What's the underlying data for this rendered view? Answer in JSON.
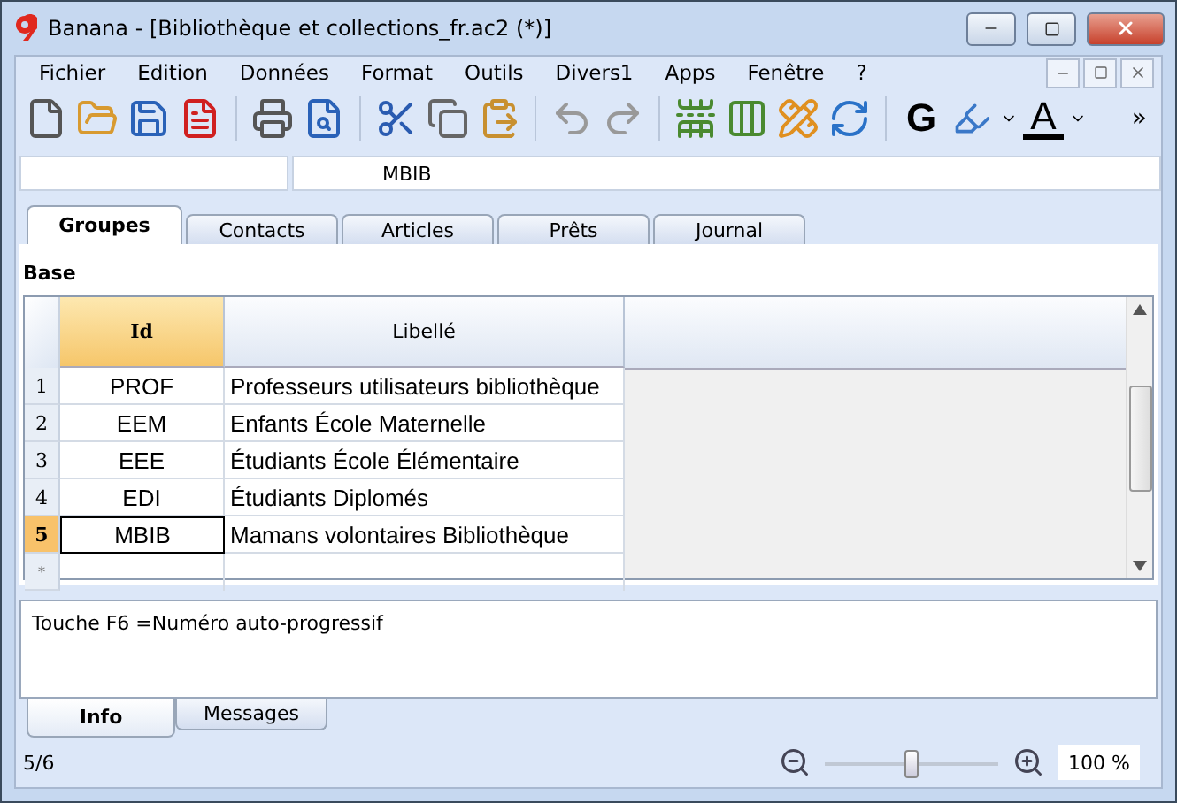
{
  "window": {
    "title": "Banana - [Bibliothèque et collections_fr.ac2 (*)]"
  },
  "menu": [
    "Fichier",
    "Edition",
    "Données",
    "Format",
    "Outils",
    "Divers1",
    "Apps",
    "Fenêtre",
    "?"
  ],
  "toolbar": {
    "bold_button": "G",
    "font_color_button": "A",
    "overflow": "»"
  },
  "cell_bar": {
    "content": "MBIB"
  },
  "tabs": [
    {
      "label": "Groupes",
      "selected": true
    },
    {
      "label": "Contacts",
      "selected": false
    },
    {
      "label": "Articles",
      "selected": false
    },
    {
      "label": "Prêts",
      "selected": false
    },
    {
      "label": "Journal",
      "selected": false
    }
  ],
  "view": "Base",
  "table": {
    "columns": [
      {
        "label": "Id",
        "selected": true
      },
      {
        "label": "Libellé",
        "selected": false
      }
    ],
    "rows": [
      {
        "number": "1",
        "id": "PROF",
        "label": "Professeurs utilisateurs bibliothèque",
        "selected": false
      },
      {
        "number": "2",
        "id": "EEM",
        "label": "Enfants École Maternelle",
        "selected": false
      },
      {
        "number": "3",
        "id": "EEE",
        "label": "Étudiants École Élémentaire",
        "selected": false
      },
      {
        "number": "4",
        "id": "EDI",
        "label": "Étudiants Diplomés",
        "selected": false
      },
      {
        "number": "5",
        "id": "MBIB",
        "label": "Mamans volontaires Bibliothèque",
        "selected": true
      }
    ],
    "new_row_marker": "*"
  },
  "info": {
    "text": "Touche F6 =Numéro auto-progressif"
  },
  "bottom_tabs": [
    {
      "label": "Info",
      "selected": true
    },
    {
      "label": "Messages",
      "selected": false
    }
  ],
  "status_bar": {
    "position": "5/6",
    "zoom": {
      "level": 0.5,
      "value": "100 %"
    }
  }
}
